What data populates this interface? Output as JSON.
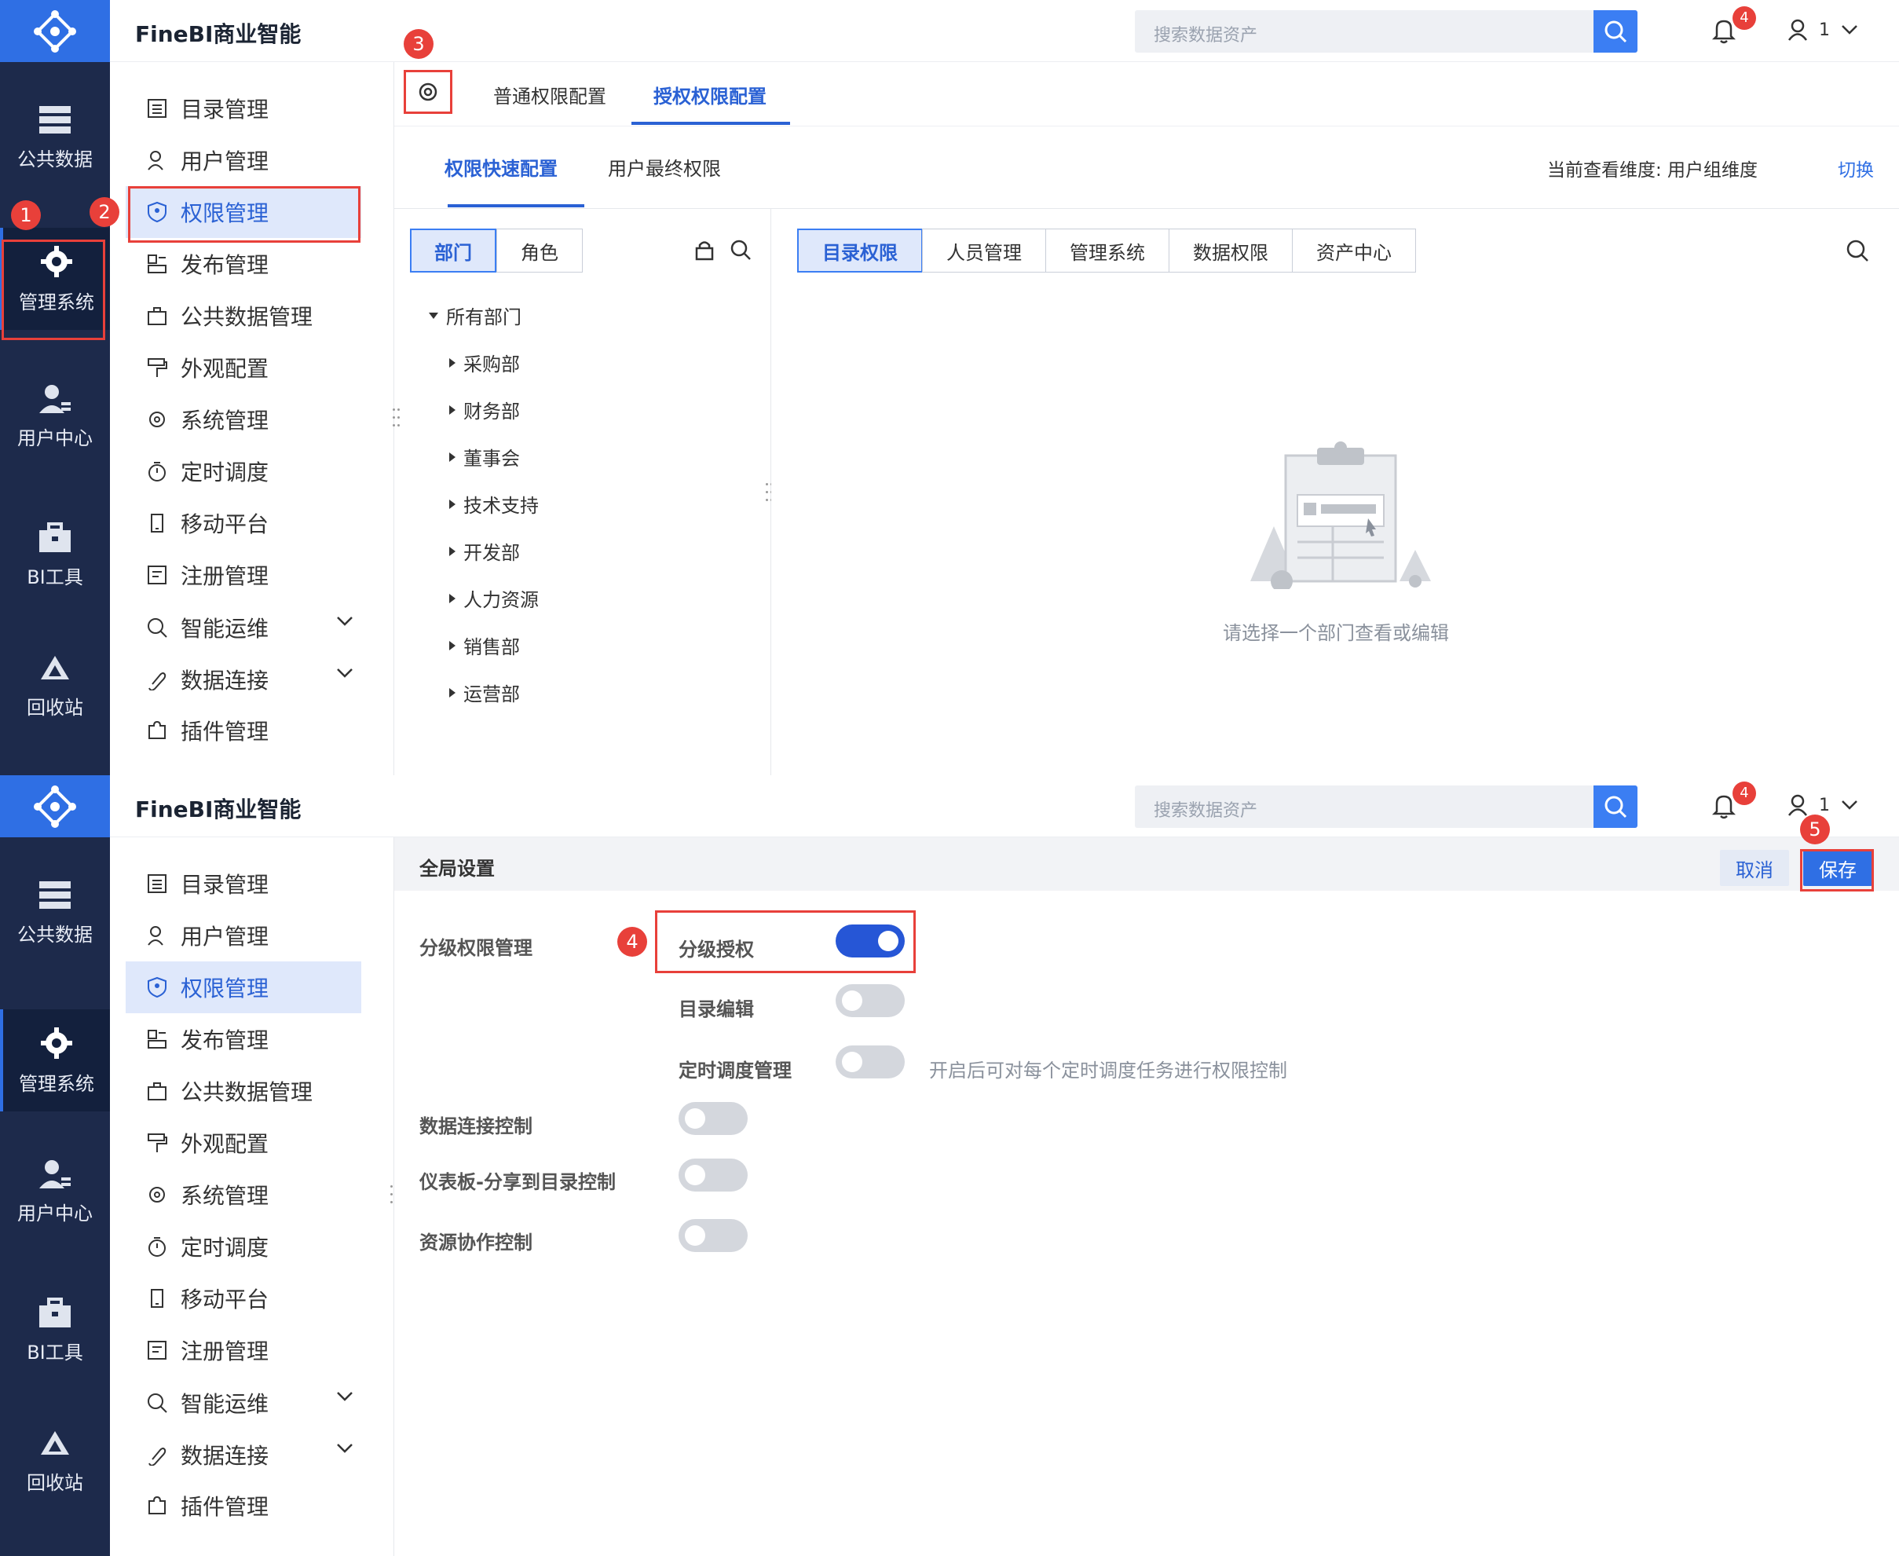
{
  "app": {
    "brand": "FineBI商业智能",
    "search_placeholder": "搜索数据资产",
    "notif_count": "4",
    "user_name": "1"
  },
  "left_nav": [
    {
      "label": "公共数据",
      "icon": "database-icon"
    },
    {
      "label": "管理系统",
      "icon": "gear-icon"
    },
    {
      "label": "用户中心",
      "icon": "user-icon"
    },
    {
      "label": "BI工具",
      "icon": "toolbox-icon"
    },
    {
      "label": "回收站",
      "icon": "recycle-icon"
    }
  ],
  "sidebar": [
    {
      "label": "目录管理"
    },
    {
      "label": "用户管理"
    },
    {
      "label": "权限管理"
    },
    {
      "label": "发布管理"
    },
    {
      "label": "公共数据管理"
    },
    {
      "label": "外观配置"
    },
    {
      "label": "系统管理"
    },
    {
      "label": "定时调度"
    },
    {
      "label": "移动平台"
    },
    {
      "label": "注册管理"
    },
    {
      "label": "智能运维"
    },
    {
      "label": "数据连接"
    },
    {
      "label": "插件管理"
    }
  ],
  "panel1": {
    "tabs": [
      "普通权限配置",
      "授权权限配置"
    ],
    "subtabs": [
      "权限快速配置",
      "用户最终权限"
    ],
    "dimension_label": "当前查看维度:  用户组维度",
    "switch_link": "切换",
    "seg": [
      "部门",
      "角色"
    ],
    "tree_root": "所有部门",
    "tree_items": [
      "采购部",
      "财务部",
      "董事会",
      "技术支持",
      "开发部",
      "人力资源",
      "销售部",
      "运营部"
    ],
    "right_tabs": [
      "目录权限",
      "人员管理",
      "管理系统",
      "数据权限",
      "资产中心"
    ],
    "empty_text": "请选择一个部门查看或编辑"
  },
  "panel2": {
    "title": "全局设置",
    "cancel": "取消",
    "save": "保存",
    "section_label": "分级权限管理",
    "settings": [
      {
        "label": "分级授权",
        "on": true
      },
      {
        "label": "目录编辑",
        "on": false
      },
      {
        "label": "定时调度管理",
        "on": false,
        "hint": "开启后可对每个定时调度任务进行权限控制"
      },
      {
        "label": "数据连接控制",
        "on": false
      },
      {
        "label": "仪表板-分享到目录控制",
        "on": false
      },
      {
        "label": "资源协作控制",
        "on": false
      }
    ]
  },
  "annotations": [
    "1",
    "2",
    "3",
    "4",
    "5"
  ],
  "colors": {
    "nav_bg": "#1d2a4b",
    "accent": "#2f6fe4",
    "annotation": "#e8403a"
  }
}
